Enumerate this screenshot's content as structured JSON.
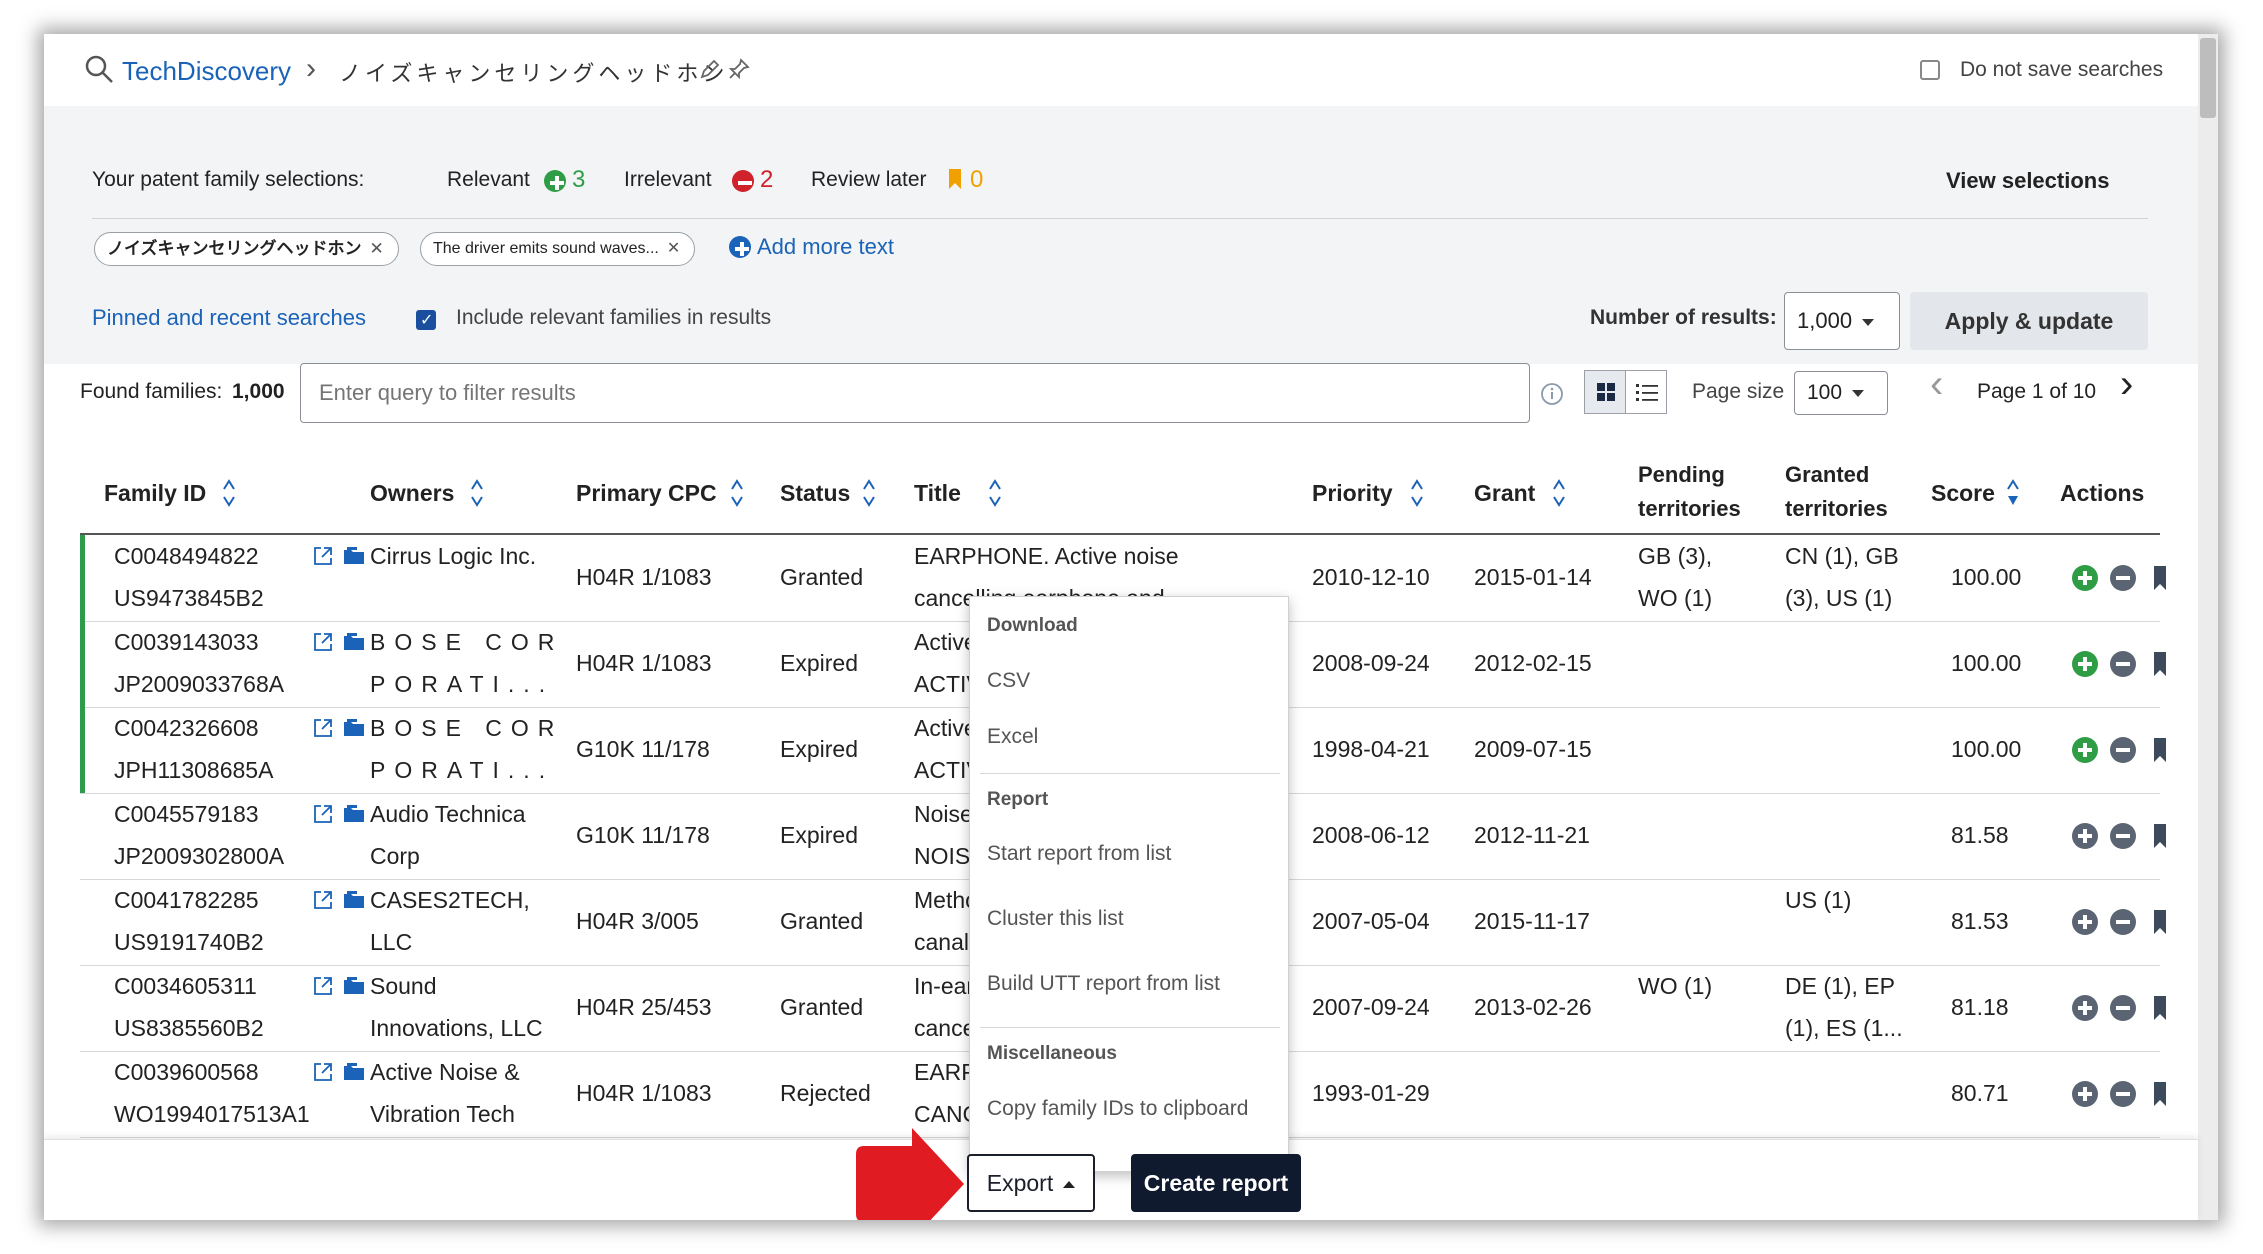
{
  "header": {
    "app_name": "TechDiscovery",
    "search_name": "ノイズキャンセリングヘッドホン",
    "do_not_save_label": "Do not save searches"
  },
  "selections": {
    "label": "Your patent family selections:",
    "relevant_label": "Relevant",
    "relevant_count": "3",
    "irrelevant_label": "Irrelevant",
    "irrelevant_count": "2",
    "review_label": "Review later",
    "review_count": "0",
    "view_label": "View selections",
    "chips": [
      "ノイズキャンセリングヘッドホン",
      "The driver emits sound waves..."
    ],
    "add_more_label": "Add more text",
    "pinned_label": "Pinned and recent searches",
    "include_relevant_label": "Include relevant families in results",
    "num_results_label": "Number of results:",
    "num_results_value": "1,000",
    "apply_label": "Apply & update"
  },
  "results": {
    "found_label": "Found families:",
    "found_count": "1,000",
    "filter_placeholder": "Enter query to filter results",
    "page_size_label": "Page size",
    "page_size_value": "100",
    "page_label": "Page 1 of 10"
  },
  "table": {
    "headers": {
      "family_id": "Family ID",
      "owners": "Owners",
      "cpc": "Primary CPC",
      "status": "Status",
      "title": "Title",
      "priority": "Priority",
      "grant": "Grant",
      "pending_1": "Pending",
      "pending_2": "territories",
      "granted_1": "Granted",
      "granted_2": "territories",
      "score": "Score",
      "actions": "Actions"
    },
    "rows": [
      {
        "id": "C0048494822",
        "pub": "US9473845B2",
        "owner1": "Cirrus Logic Inc.",
        "owner2": "",
        "cpc": "H04R 1/1083",
        "status": "Granted",
        "title1": "EARPHONE. Active noise",
        "title2": "cancelling earphone and",
        "priority": "2010-12-10",
        "grant": "2015-01-14",
        "pending1": "GB (3),",
        "pending2": "WO (1)",
        "granted1": "CN (1), GB",
        "granted2": "(3), US (1)",
        "score": "100.00",
        "relevant": true
      },
      {
        "id": "C0039143033",
        "pub": "JP2009033768A",
        "owner1": "BOSE COR",
        "owner2": "PORATI...",
        "cpc": "H04R 1/1083",
        "status": "Expired",
        "title1": "Active noise reducing",
        "title2": "ACTIVE NOISE",
        "priority": "2008-09-24",
        "grant": "2012-02-15",
        "pending1": "",
        "pending2": "",
        "granted1": "",
        "granted2": "",
        "score": "100.00",
        "relevant": true
      },
      {
        "id": "C0042326608",
        "pub": "JPH11308685A",
        "owner1": "BOSE COR",
        "owner2": "PORATI...",
        "cpc": "G10K 11/178",
        "status": "Expired",
        "title1": "Active noise reduction",
        "title2": "ACTIVE NOISE",
        "priority": "1998-04-21",
        "grant": "2009-07-15",
        "pending1": "",
        "pending2": "",
        "granted1": "",
        "granted2": "",
        "score": "100.00",
        "relevant": true
      },
      {
        "id": "C0045579183",
        "pub": "JP2009302800A",
        "owner1": "Audio Technica",
        "owner2": "Corp",
        "cpc": "G10K 11/178",
        "status": "Expired",
        "title1": "Noise cancelling",
        "title2": "NOISE CANCELLING",
        "priority": "2008-06-12",
        "grant": "2012-11-21",
        "pending1": "",
        "pending2": "",
        "granted1": "",
        "granted2": "",
        "score": "81.58",
        "relevant": false
      },
      {
        "id": "C0041782285",
        "pub": "US9191740B2",
        "owner1": "CASES2TECH,",
        "owner2": "LLC",
        "cpc": "H04R 3/005",
        "status": "Granted",
        "title1": "Method and apparatus",
        "title2": "canal",
        "priority": "2007-05-04",
        "grant": "2015-11-17",
        "pending1": "",
        "pending2": "",
        "granted1": "US (1)",
        "granted2": "",
        "score": "81.53",
        "relevant": false
      },
      {
        "id": "C0034605311",
        "pub": "US8385560B2",
        "owner1": "Sound",
        "owner2": "Innovations, LLC",
        "cpc": "H04R 25/453",
        "status": "Granted",
        "title1": "In-ear",
        "title2": "cancel",
        "priority": "2007-09-24",
        "grant": "2013-02-26",
        "pending1": "WO (1)",
        "pending2": "",
        "granted1": "DE (1), EP",
        "granted2": "(1), ES (1...",
        "score": "81.18",
        "relevant": false
      },
      {
        "id": "C0039600568",
        "pub": "WO1994017513A1",
        "owner1": "Active Noise &",
        "owner2": "Vibration Tech",
        "cpc": "H04R 1/1083",
        "status": "Rejected",
        "title1": "EARPHONE",
        "title2": "CANCEL",
        "priority": "1993-01-29",
        "grant": "",
        "pending1": "",
        "pending2": "",
        "granted1": "",
        "granted2": "",
        "score": "80.71",
        "relevant": false
      }
    ]
  },
  "export_menu": {
    "download_header": "Download",
    "csv": "CSV",
    "excel": "Excel",
    "report_header": "Report",
    "start_report": "Start report from list",
    "cluster": "Cluster this list",
    "utt_report": "Build UTT report from list",
    "misc_header": "Miscellaneous",
    "copy_ids": "Copy family IDs to clipboard"
  },
  "footer": {
    "export_label": "Export",
    "create_report_label": "Create report"
  },
  "colors": {
    "link": "#1a63b8",
    "relevant": "#2f9d45",
    "irrelevant": "#d0222b",
    "review": "#f0a000",
    "arrow": "#e01b22",
    "dark_button": "#0f1a2e"
  }
}
